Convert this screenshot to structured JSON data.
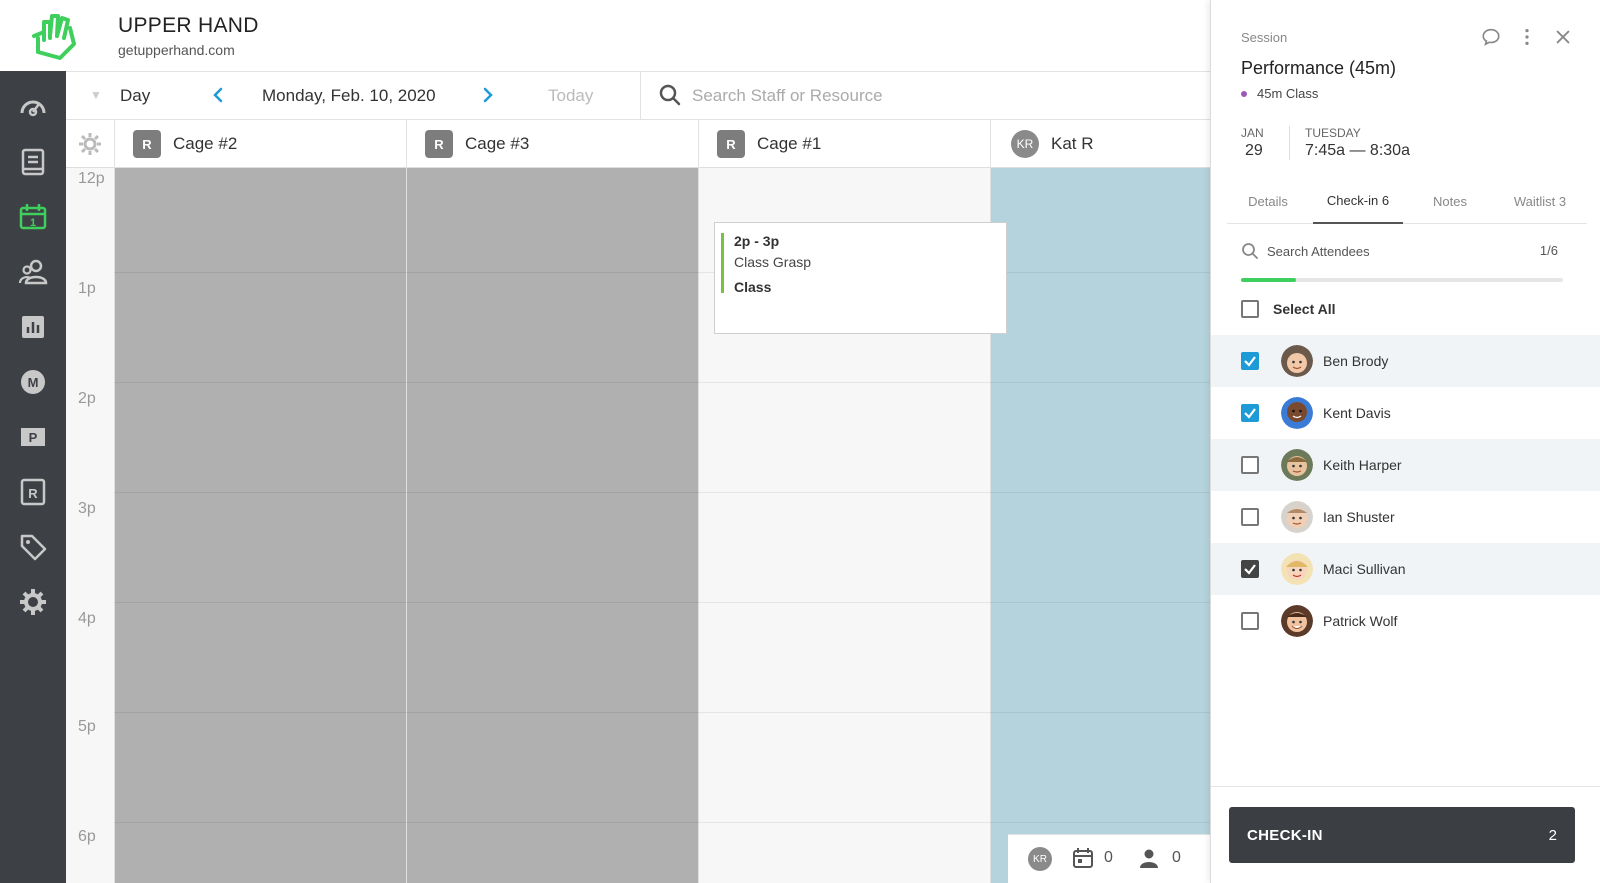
{
  "brand": {
    "name": "UPPER HAND",
    "url": "getupperhand.com",
    "color": "#3ecf5c"
  },
  "sidebar": {
    "items": [
      {
        "icon": "dashboard-icon"
      },
      {
        "icon": "book-icon"
      },
      {
        "icon": "calendar-icon",
        "active": true
      },
      {
        "icon": "users-icon"
      },
      {
        "icon": "reports-icon"
      },
      {
        "icon": "marketing-icon"
      },
      {
        "icon": "point-of-sale-icon"
      },
      {
        "icon": "resources-icon"
      },
      {
        "icon": "tag-icon"
      },
      {
        "icon": "settings-icon"
      }
    ]
  },
  "toolbar": {
    "view": "Day",
    "date": "Monday, Feb. 10, 2020",
    "today": "Today",
    "search_placeholder": "Search Staff or Resource"
  },
  "columns": [
    {
      "badge": "R",
      "label": "Cage #2"
    },
    {
      "badge": "R",
      "label": "Cage #3"
    },
    {
      "badge": "R",
      "label": "Cage #1"
    },
    {
      "badge": "KR",
      "label": "Kat R"
    }
  ],
  "times": [
    "12p",
    "1p",
    "2p",
    "3p",
    "4p",
    "5p",
    "6p"
  ],
  "event": {
    "time": "2p - 3p",
    "name": "Class Grasp",
    "type": "Class"
  },
  "kr_footer": {
    "initials": "KR",
    "events_count": "0",
    "attendees_count": "0"
  },
  "session": {
    "kicker": "Session",
    "title": "Performance (45m)",
    "subtitle": "45m Class",
    "month": "JAN",
    "day": "29",
    "weekday": "TUESDAY",
    "time_range": "7:45a — 8:30a"
  },
  "tabs": [
    {
      "label": "Details"
    },
    {
      "label": "Check-in 6",
      "active": true
    },
    {
      "label": "Notes"
    },
    {
      "label": "Waitlist 3"
    }
  ],
  "attendees": {
    "search_placeholder": "Search Attendees",
    "count": "1/6",
    "progress_fraction": 0.17,
    "select_all": "Select All",
    "list": [
      {
        "name": "Ben Brody",
        "checked": "blue"
      },
      {
        "name": "Kent Davis",
        "checked": "blue"
      },
      {
        "name": "Keith Harper",
        "checked": "none"
      },
      {
        "name": "Ian Shuster",
        "checked": "none"
      },
      {
        "name": "Maci Sullivan",
        "checked": "dark"
      },
      {
        "name": "Patrick Wolf",
        "checked": "none"
      }
    ]
  },
  "checkin": {
    "label": "CHECK-IN",
    "count": "2"
  }
}
